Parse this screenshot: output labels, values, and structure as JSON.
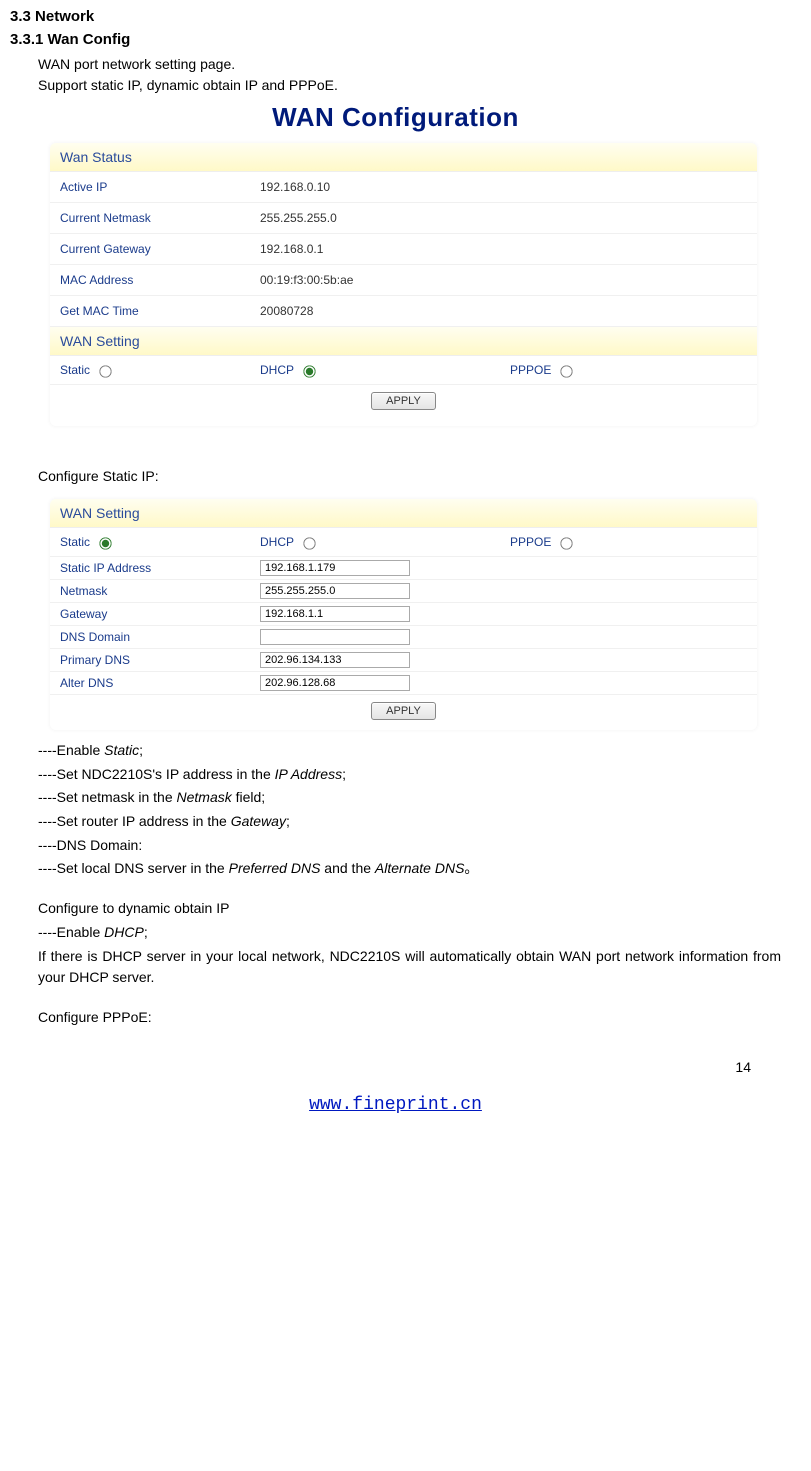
{
  "section": "3.3 Network",
  "subsection": "3.3.1 Wan Config",
  "intro": {
    "line1": "WAN port network setting page.",
    "line2": "Support static IP, dynamic obtain IP and PPPoE."
  },
  "wan_title": "WAN Configuration",
  "wan_status": {
    "header": "Wan Status",
    "rows": [
      {
        "k": "Active IP",
        "v": "192.168.0.10"
      },
      {
        "k": "Current Netmask",
        "v": "255.255.255.0"
      },
      {
        "k": "Current Gateway",
        "v": "192.168.0.1"
      },
      {
        "k": "MAC Address",
        "v": "00:19:f3:00:5b:ae"
      },
      {
        "k": "Get MAC Time",
        "v": "20080728"
      }
    ]
  },
  "wan_setting1": {
    "header": "WAN Setting",
    "opts": {
      "static": "Static",
      "dhcp": "DHCP",
      "pppoe": "PPPOE"
    },
    "selected": "dhcp",
    "apply": "APPLY"
  },
  "configure_static_label": "Configure Static IP:",
  "wan_setting2": {
    "header": "WAN Setting",
    "opts": {
      "static": "Static",
      "dhcp": "DHCP",
      "pppoe": "PPPOE"
    },
    "selected": "static",
    "fields": [
      {
        "label": "Static IP Address",
        "value": "192.168.1.179"
      },
      {
        "label": "Netmask",
        "value": "255.255.255.0"
      },
      {
        "label": "Gateway",
        "value": "192.168.1.1"
      },
      {
        "label": "DNS Domain",
        "value": ""
      },
      {
        "label": "Primary DNS",
        "value": "202.96.134.133"
      },
      {
        "label": "Alter DNS",
        "value": "202.96.128.68"
      }
    ],
    "apply": "APPLY"
  },
  "explain": {
    "l1a": "----Enable ",
    "l1b": "Static",
    "l1c": ";",
    "l2a": "----Set NDC2210S's IP address in the ",
    "l2b": "IP Address",
    "l2c": ";",
    "l3a": "----Set netmask in the ",
    "l3b": "Netmask",
    "l3c": " field;",
    "l4a": "----Set router IP address in the ",
    "l4b": "Gateway",
    "l4c": ";",
    "l5": "----DNS Domain:",
    "l6a": "----Set local DNS server in the ",
    "l6b": "Preferred DNS",
    "l6c": " and the ",
    "l6d": "Alternate DNS",
    "l6e": "。"
  },
  "dyn": {
    "title": "Configure to dynamic obtain IP",
    "l1a": "----Enable ",
    "l1b": "DHCP",
    "l1c": ";",
    "l2": "If there is DHCP server in your local network, NDC2210S will automatically obtain WAN port network information from your DHCP server."
  },
  "pppoe_title": "Configure PPPoE:",
  "page_number": "14",
  "footer_url": "www.fineprint.cn"
}
